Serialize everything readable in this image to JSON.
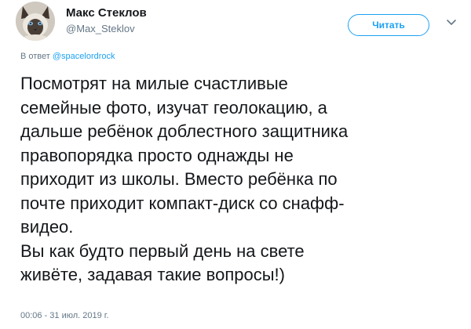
{
  "author": {
    "display_name": "Макс Стеклов",
    "handle": "@Max_Steklov",
    "avatar_icon": "siamese-cat-avatar"
  },
  "actions": {
    "follow_label": "Читать",
    "menu_icon": "chevron-down-icon"
  },
  "reply": {
    "prefix": "В ответ ",
    "to": "@spacelordrock"
  },
  "tweet": {
    "text": "Посмотрят на милые счастливые\nсемейные фото, изучат геолокацию, а\nдальше ребёнок доблестного защитника\nправопорядка просто однажды не\nприходит из школы. Вместо ребёнка по\nпочте приходит компакт-диск со снафф-\nвидео.\nВы как будто первый день на свете\nживёте, задавая такие вопросы!)",
    "timestamp": "00:06 - 31 июл. 2019 г."
  },
  "colors": {
    "accent": "#1da1f2",
    "text": "#14171a",
    "muted": "#657786"
  }
}
